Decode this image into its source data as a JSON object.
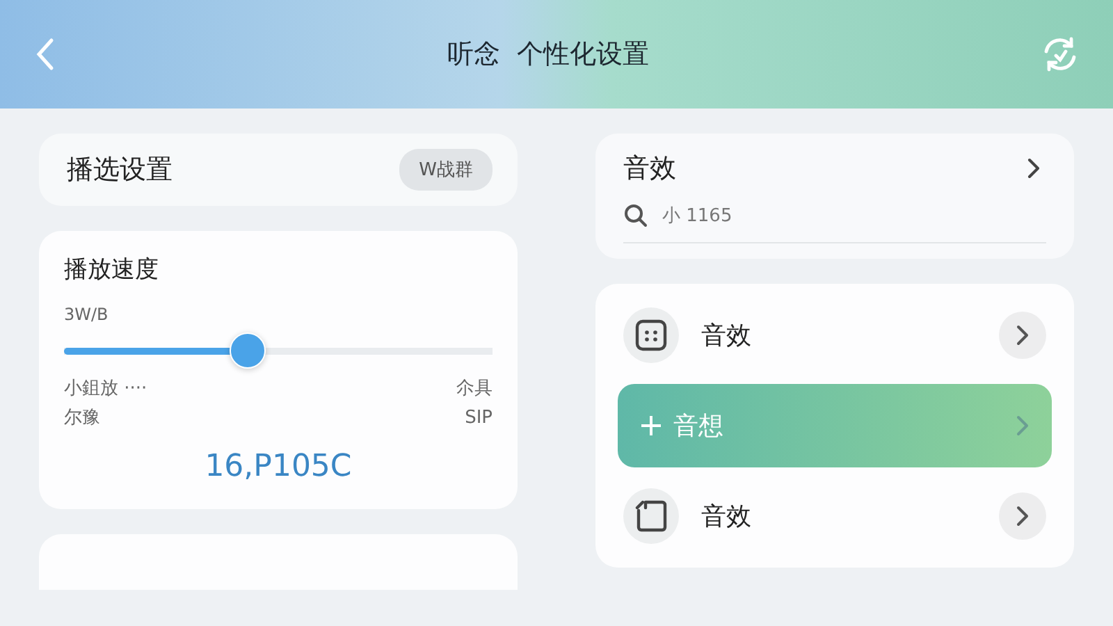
{
  "header": {
    "title": "听念  个性化设置"
  },
  "playback_settings": {
    "title": "播选设置",
    "button": "W战群"
  },
  "speed": {
    "title": "播放速度",
    "caption": "3W/B",
    "level": 0.43,
    "left_labels": [
      "小鉏放 ····",
      "尔豫"
    ],
    "right_labels": [
      "尒具",
      "SIP"
    ],
    "value": "16,P105C"
  },
  "sound_effects": {
    "title": "音效",
    "search": {
      "value": "小 1165"
    }
  },
  "effect_rows": [
    {
      "kind": "item",
      "label": "音效"
    },
    {
      "kind": "highlight",
      "label": "音想"
    },
    {
      "kind": "item",
      "label": "音效"
    }
  ]
}
